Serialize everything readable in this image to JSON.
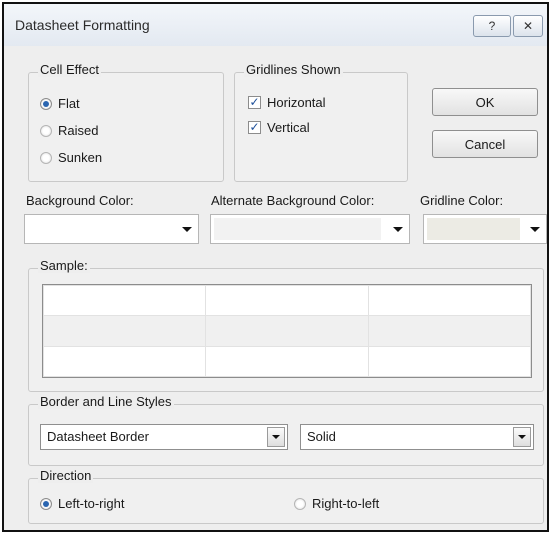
{
  "window": {
    "title": "Datasheet Formatting",
    "help_glyph": "?",
    "close_glyph": "✕"
  },
  "cell_effect": {
    "label": "Cell Effect",
    "options": [
      "Flat",
      "Raised",
      "Sunken"
    ],
    "selected": "Flat"
  },
  "gridlines": {
    "label": "Gridlines Shown",
    "horizontal_label": "Horizontal",
    "vertical_label": "Vertical",
    "horizontal_checked": true,
    "vertical_checked": true,
    "check_glyph": "✓"
  },
  "buttons": {
    "ok": "OK",
    "cancel": "Cancel"
  },
  "colors": {
    "background_label": "Background Color:",
    "alternate_label": "Alternate Background Color:",
    "gridline_label": "Gridline Color:",
    "background_value": "#ffffff",
    "alternate_value": "#f2f2f2",
    "gridline_value": "#ecebe4"
  },
  "sample": {
    "label": "Sample:"
  },
  "border_styles": {
    "label": "Border and Line Styles",
    "border_value": "Datasheet Border",
    "line_value": "Solid"
  },
  "direction": {
    "label": "Direction",
    "left_to_right": "Left-to-right",
    "right_to_left": "Right-to-left",
    "selected": "Left-to-right"
  },
  "icons": {
    "help": "help-icon",
    "close": "close-icon",
    "dropdown": "chevron-down-icon"
  }
}
